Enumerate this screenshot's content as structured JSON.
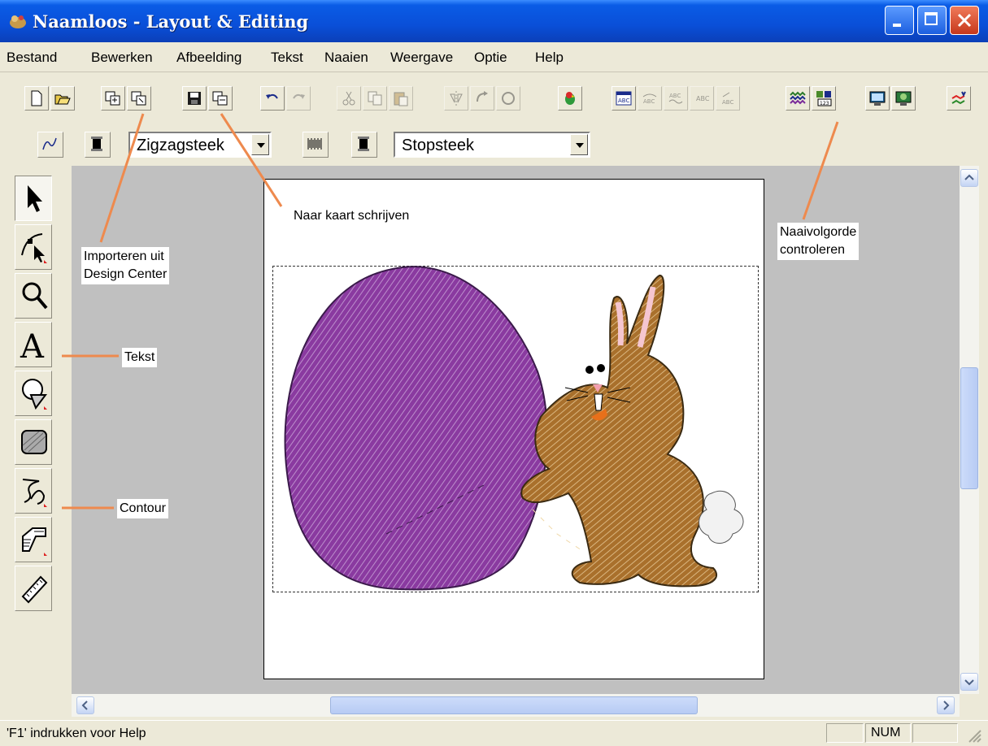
{
  "window": {
    "title": "Naamloos - Layout & Editing"
  },
  "menu": [
    "Bestand",
    "Bewerken",
    "Afbeelding",
    "Tekst",
    "Naaien",
    "Weergave",
    "Optie",
    "Help"
  ],
  "toolbar2": {
    "stitch_type_1": "Zigzagsteek",
    "stitch_type_2": "Stopsteek"
  },
  "callouts": {
    "import": [
      "Importeren uit",
      "Design Center"
    ],
    "write_card": "Naar kaart schrijven",
    "sewing_order": [
      "Naaivolgorde",
      "controleren"
    ],
    "text_tool": "Tekst",
    "contour_tool": "Contour"
  },
  "status": {
    "help_text": "'F1' indrukken voor Help",
    "num": "NUM"
  },
  "colors": {
    "egg": "#8a3aa0",
    "bunny": "#a9702c",
    "callout_line": "#ee8a4e",
    "titlebar": "#0a4fd8"
  },
  "icons": {
    "titlebar": [
      "app-icon",
      "minimize-icon",
      "maximize-icon",
      "close-icon"
    ],
    "toolbar1": [
      "new-icon",
      "open-icon",
      "import-design-center-icon",
      "import-icon",
      "save-icon",
      "write-to-card-icon",
      "undo-icon",
      "redo-icon",
      "cut-icon",
      "copy-icon",
      "paste-icon",
      "mirror-icon",
      "rotate-icon",
      "rotate-reset-icon",
      "parrot-icon",
      "text-wizard-icon",
      "text-arc-icon",
      "text-wave-icon",
      "text-shadow-icon",
      "text-slant-icon",
      "sewing-order-icon",
      "check-sewing-order-icon",
      "preview-icon",
      "realistic-preview-icon",
      "design-property-icon"
    ],
    "palette": [
      "select-arrow-icon",
      "point-edit-icon",
      "zoom-icon",
      "text-icon",
      "shape-icon",
      "rectangle-fill-icon",
      "contour-icon",
      "punch-icon",
      "ruler-icon"
    ]
  }
}
